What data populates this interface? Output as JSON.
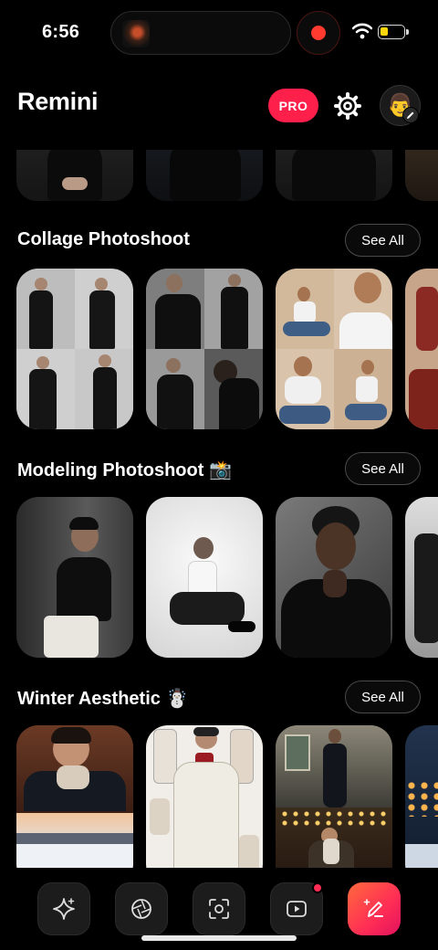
{
  "status_bar": {
    "time": "6:56"
  },
  "header": {
    "title": "Remini",
    "pro_label": "PRO",
    "avatar_emoji": "👨"
  },
  "sections": [
    {
      "title": "Collage Photoshoot",
      "see_all": "See All"
    },
    {
      "title": "Modeling Photoshoot 📸",
      "see_all": "See All"
    },
    {
      "title": "Winter Aesthetic ☃️",
      "see_all": "See All"
    }
  ],
  "bottom_nav": {
    "items": [
      {
        "icon": "sparkles-icon"
      },
      {
        "icon": "aperture-icon"
      },
      {
        "icon": "face-scan-icon"
      },
      {
        "icon": "video-play-icon"
      },
      {
        "icon": "magic-pen-icon"
      }
    ]
  },
  "colors": {
    "accent": "#ff1f4b",
    "background": "#000000",
    "record": "#ff3b30"
  }
}
